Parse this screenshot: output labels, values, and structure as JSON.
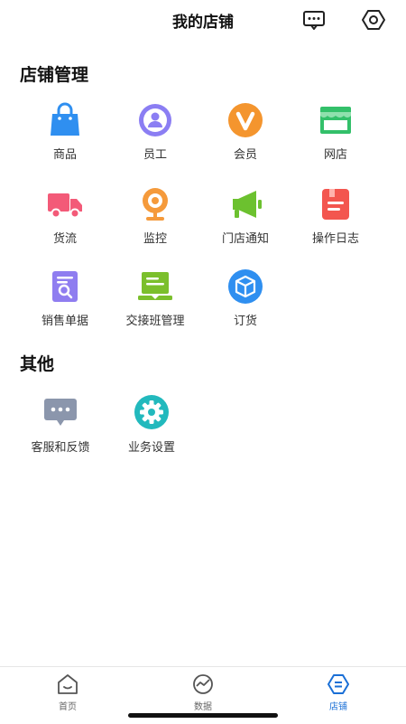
{
  "header": {
    "title": "我的店铺",
    "message_icon": "chat-bubble-icon",
    "settings_icon": "hexagon-gear-icon"
  },
  "sections": {
    "manage": {
      "title": "店铺管理",
      "items": [
        {
          "label": "商品",
          "icon": "shopping-bag-icon",
          "color": "#2f8ff0"
        },
        {
          "label": "员工",
          "icon": "person-badge-icon",
          "color": "#8b7ef3"
        },
        {
          "label": "会员",
          "icon": "vip-v-icon",
          "color": "#f4952e"
        },
        {
          "label": "网店",
          "icon": "storefront-icon",
          "color": "#33c06a"
        },
        {
          "label": "货流",
          "icon": "delivery-truck-icon",
          "color": "#f35a78"
        },
        {
          "label": "监控",
          "icon": "webcam-icon",
          "color": "#f59a3b"
        },
        {
          "label": "门店通知",
          "icon": "megaphone-icon",
          "color": "#6cc12f"
        },
        {
          "label": "操作日志",
          "icon": "log-document-icon",
          "color": "#f3564f"
        },
        {
          "label": "销售单据",
          "icon": "receipt-search-icon",
          "color": "#8f7df0"
        },
        {
          "label": "交接班管理",
          "icon": "laptop-handover-icon",
          "color": "#7bbf2c"
        },
        {
          "label": "订货",
          "icon": "package-box-icon",
          "color": "#2f8ff0"
        }
      ]
    },
    "other": {
      "title": "其他",
      "items": [
        {
          "label": "客服和反馈",
          "icon": "feedback-chat-icon",
          "color": "#8b96ac"
        },
        {
          "label": "业务设置",
          "icon": "gear-icon",
          "color": "#22b9bd"
        }
      ]
    }
  },
  "tabbar": {
    "items": [
      {
        "label": "首页",
        "icon": "home-icon"
      },
      {
        "label": "数据",
        "icon": "data-chart-icon"
      },
      {
        "label": "店铺",
        "icon": "store-icon"
      }
    ],
    "active": "店铺",
    "active_color": "#1a6fd6"
  }
}
